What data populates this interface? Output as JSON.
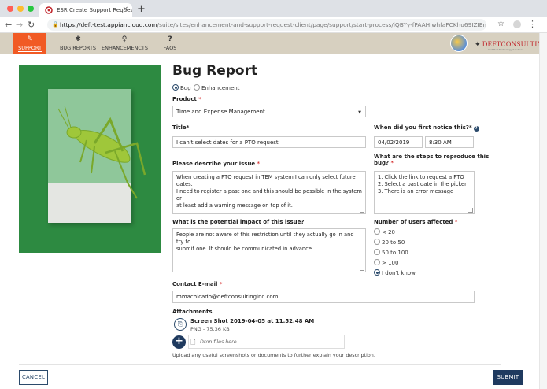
{
  "browser": {
    "tab_title": "ESR Create Support Request -",
    "tab_close": "×",
    "new_tab": "+",
    "url_host": "https://deft-test.appiancloud.com",
    "url_path": "/suite/sites/enhancement-and-support-request-client/page/support/start-process/iQBYy-fPAAHIwhfaFCKhu69IZIEnKU-xa6b-0MZF...",
    "star": "☆",
    "colors": {
      "close": "#ff5f57",
      "minimize": "#febc2e",
      "maximize": "#28c840"
    }
  },
  "nav": {
    "items": [
      {
        "label": "SUPPORT",
        "icon": "wrench-icon",
        "glyph": "✎"
      },
      {
        "label": "BUG REPORTS",
        "icon": "bug-icon",
        "glyph": "✱"
      },
      {
        "label": "ENHANCEMENCTS",
        "icon": "lightbulb-icon",
        "glyph": "♀"
      },
      {
        "label": "FAQS",
        "icon": "question-icon",
        "glyph": "?"
      }
    ],
    "logo": "DEFTCONSULTING",
    "logo_sub": "Certified Technology Solutions",
    "accent": "#f15a24",
    "header_bg": "#d7d0c0"
  },
  "form": {
    "title": "Bug Report",
    "type_options": [
      {
        "label": "Bug",
        "selected": true
      },
      {
        "label": "Enhancement",
        "selected": false
      }
    ],
    "product": {
      "label": "Product",
      "required_mark": "*",
      "value": "Time and Expense Management"
    },
    "title_field": {
      "label": "Title*",
      "value": "I can't select dates for a PTO request"
    },
    "first_notice": {
      "label": "When did you first notice this?*",
      "date": "04/02/2019",
      "time": "8:30 AM"
    },
    "issue": {
      "label": "Please describe your issue",
      "required_mark": "*",
      "value": "When creating a PTO request in TEM system I can only select future dates.\nI need to register a past one and this should be possible in the system or\nat least add a warning message on top of it."
    },
    "steps": {
      "label_line1": "What are the steps to reproduce this",
      "label_line2": "bug?",
      "required_mark": "*",
      "value": "1. Click the link to request a PTO\n2. Select a past date in the picker\n3. There is an error message"
    },
    "impact": {
      "label": "What is the potential impact of this issue?",
      "value": "People are not aware of this restriction until they actually go in and try to\nsubmit one. It should be communicated in advance."
    },
    "users_affected": {
      "label": "Number of users affected",
      "required_mark": "*",
      "options": [
        {
          "label": "< 20",
          "selected": false
        },
        {
          "label": "20 to 50",
          "selected": false
        },
        {
          "label": "50 to 100",
          "selected": false
        },
        {
          "label": "> 100",
          "selected": false
        },
        {
          "label": "I don't know",
          "selected": true
        }
      ]
    },
    "email": {
      "label": "Contact E-mail",
      "required_mark": "*",
      "value": "mmachicado@deftconsultinginc.com"
    },
    "attachments": {
      "label": "Attachments",
      "file_name": "Screen Shot 2019-04-05 at 11.52.48 AM",
      "file_meta": "PNG - 75.36 KB",
      "drop_placeholder": "Drop files here",
      "hint": "Upload any useful screenshots or documents to further explain your description."
    },
    "cancel_label": "CANCEL",
    "submit_label": "SUBMIT",
    "brand_color": "#1f3a5f"
  }
}
